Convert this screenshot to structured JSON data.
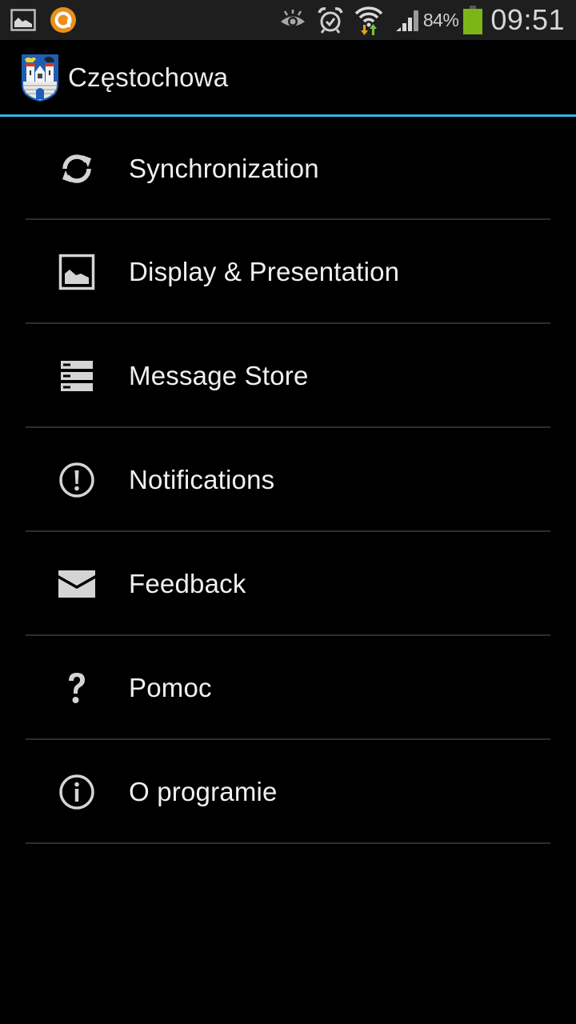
{
  "status_bar": {
    "left_icons": [
      "gallery-notification-icon",
      "app-notification-icon"
    ],
    "right_icons": [
      "eye-smart-stay-icon",
      "alarm-clock-icon",
      "wifi-icon",
      "cellular-signal-icon",
      "battery-icon"
    ],
    "battery_percent": "84%",
    "time": "09:51",
    "colors": {
      "background": "#1e1e1e",
      "battery_fill": "#7cb518",
      "wifi_down_arrow": "#e8a317",
      "wifi_up_arrow": "#7cc142",
      "app_notification": "#e8901a"
    }
  },
  "action_bar": {
    "logo": "czestochowa-coat-of-arms",
    "title": "Częstochowa",
    "accent_color": "#33b5e5"
  },
  "menu": {
    "items": [
      {
        "id": "synchronization",
        "icon": "sync-icon",
        "label": "Synchronization"
      },
      {
        "id": "display",
        "icon": "image-icon",
        "label": "Display & Presentation"
      },
      {
        "id": "message-store",
        "icon": "storage-icon",
        "label": "Message Store"
      },
      {
        "id": "notifications",
        "icon": "alert-icon",
        "label": "Notifications"
      },
      {
        "id": "feedback",
        "icon": "mail-icon",
        "label": "Feedback"
      },
      {
        "id": "help",
        "icon": "help-icon",
        "label": "Pomoc"
      },
      {
        "id": "about",
        "icon": "info-icon",
        "label": "O programie"
      }
    ]
  }
}
